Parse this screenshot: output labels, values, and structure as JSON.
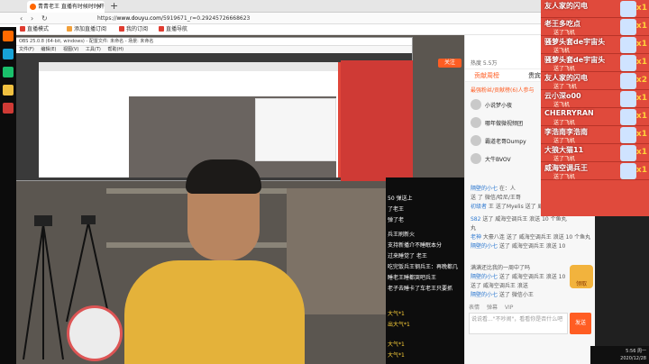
{
  "browser": {
    "tab_title": "青青老王 直播有时候时时开",
    "tab_close": "×",
    "new_tab": "+",
    "back": "‹",
    "forward": "›",
    "refresh": "↻",
    "url_prefix": "https://",
    "url_host": "www.douyu.com",
    "url_path": "/5919671_r=0.29245726668623",
    "bookmarks": [
      {
        "label": "直播模式",
        "color": "#e03b2f"
      },
      {
        "label": "添加直播订阅",
        "color": "#f2a03a"
      },
      {
        "label": "我的订阅",
        "color": "#e03b2f"
      },
      {
        "label": "直播导航",
        "color": "#e03b2f"
      }
    ]
  },
  "left_strip": {
    "icons": [
      "douyu-icon",
      "browser-icon",
      "chat-icon",
      "folder-icon",
      "game-icon"
    ]
  },
  "nested_window": {
    "title": "OBS 25.0.8 (64-bit, windows) - 配置文件: 未命名 - 场景: 未命名",
    "menu": "文件(F) 编辑(E) 视图(V) 工具(T) 帮助(H)"
  },
  "stream": {
    "danmaku": [
      "50 弹送上",
      "了老王",
      "弹了老",
      "兵王刷新火",
      "支持新播介不睡眠本分",
      "过来睡觉了 老王",
      "吃完饭兵王钢兵王：再晚都几",
      "睡老王睡都哭吧兵王",
      "老子去睡卡了车老王只要抓",
      "大气*1",
      "出大气*1",
      "大气*1",
      "大气*1"
    ]
  },
  "sidebar": {
    "follow": "关注",
    "viewer_text": "热度 5.5万",
    "tabs": [
      "贡献周榜",
      "贵宾(1130)"
    ],
    "rank_title": "最强粉丝/贡献榜(6)人参与",
    "ranks": [
      "小说梦小夜",
      "哪年做微视频团",
      "霸道老哥Dumpy",
      "大牛BVOV"
    ],
    "chat": [
      {
        "user": "隔壁的小七",
        "text": " 在：人"
      },
      {
        "user": "",
        "text": "送 了 微信/哈尼/王哥"
      },
      {
        "user": "初级者",
        "text": " 王 送了Myelis 送了 威海空调 兵王"
      },
      {
        "user": "S82",
        "text": " 送了 威海空调兵王 浪送 10 个鱼丸"
      },
      {
        "user": "",
        "text": "丸"
      },
      {
        "user": "老神",
        "text": " 大豪八连 送了 威海空调兵王 浪送 10 个鱼丸"
      },
      {
        "user": "隔壁的小七",
        "text": " 送了 威海空调兵王 浪送 10"
      },
      {
        "user": "",
        "text": "满满还比我的一周中了吗"
      },
      {
        "user": "隔壁的小七",
        "text": " 送了 威海空调兵王 浪送 10"
      },
      {
        "user": "",
        "text": "送了 威海空调兵王 浪送"
      },
      {
        "user": "隔壁的小七",
        "text": " 送了 微信小王"
      }
    ],
    "reward_label": "领取",
    "input_placeholder": "说说看...\"不吵闹\"，看看你是否什么吧",
    "send": "发送",
    "mini_labels": [
      "表情",
      "弹幕",
      "VIP"
    ]
  },
  "gifts": [
    {
      "name": "友人家的闪电",
      "sub": "",
      "count": "x1"
    },
    {
      "name": "老王多吃点",
      "sub": "送了飞机",
      "count": "x1"
    },
    {
      "name": "骚萝头套de宇宙头",
      "sub": "送飞机",
      "count": "x1"
    },
    {
      "name": "骚萝头套de宇宙头",
      "sub": "送了飞机",
      "count": "x1"
    },
    {
      "name": "友人家的闪电",
      "sub": "送了 飞机",
      "count": "x2"
    },
    {
      "name": "云小深o00",
      "sub": "送飞机",
      "count": "x1"
    },
    {
      "name": "CHERRYRAN",
      "sub": "送了飞机",
      "count": "x1"
    },
    {
      "name": "李浩南李浩南",
      "sub": "送了飞机",
      "count": "x1"
    },
    {
      "name": "大狼大猫11",
      "sub": "送了飞机",
      "count": "x1"
    },
    {
      "name": "威海空调兵王",
      "sub": "送了飞机",
      "count": "x1"
    }
  ],
  "taskbar": {
    "time": "5:56 周一",
    "date": "2020/12/28"
  }
}
